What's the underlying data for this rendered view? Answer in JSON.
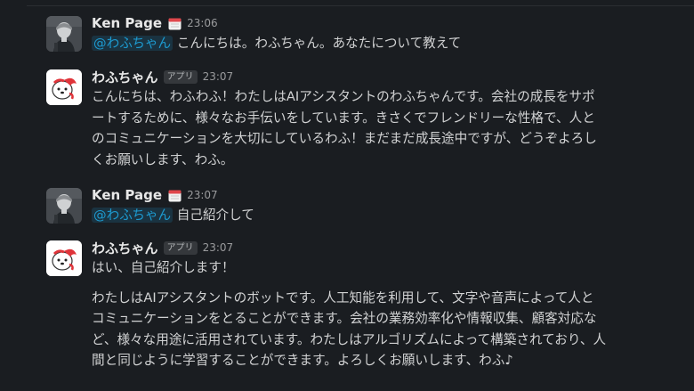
{
  "messages": [
    {
      "author": "Ken Page",
      "time": "23:06",
      "mention": "@わふちゃん",
      "text": "こんにちは。わふちゃん。あなたについて教えて"
    },
    {
      "author": "わふちゃん",
      "badge": "アプリ",
      "time": "23:07",
      "lines": [
        "こんにちは、わふわふ！わたしはAIアシスタントのわふちゃんです。会社の成長をサポ",
        "ートするために、様々なお手伝いをしています。きさくでフレンドリーな性格で、人と",
        "のコミュニケーションを大切にしているわふ！まだまだ成長途中ですが、どうぞよろし",
        "くお願いします、わふ。"
      ]
    },
    {
      "author": "Ken Page",
      "time": "23:07",
      "mention": "@わふちゃん",
      "text": "自己紹介して"
    },
    {
      "author": "わふちゃん",
      "badge": "アプリ",
      "time": "23:07",
      "first": "はい、自己紹介します！",
      "lines": [
        "わたしはAIアシスタントのボットです。人工知能を利用して、文字や音声によって人と",
        "コミュニケーションをとることができます。会社の業務効率化や情報収集、顧客対応な",
        "ど、様々な用途に活用されています。わたしはアルゴリズムによって構築されており、人",
        "間と同じように学習することができます。よろしくお願いします、わふ♪"
      ]
    }
  ]
}
